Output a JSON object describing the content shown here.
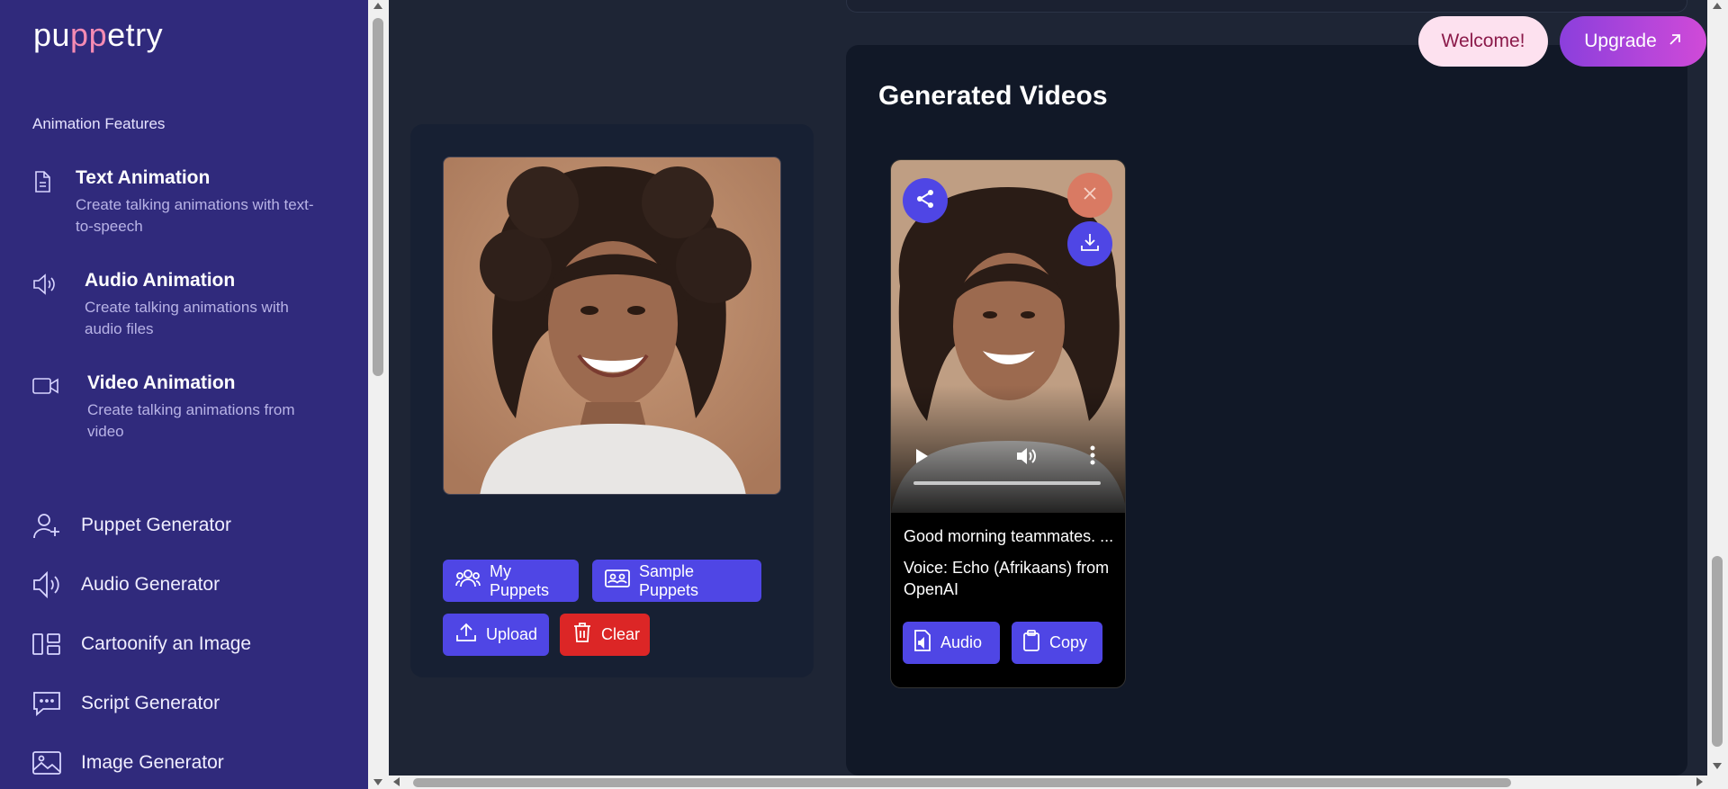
{
  "logo": {
    "pre": "pu",
    "mid": "pp",
    "post": "etry"
  },
  "sidebar": {
    "section_title": "Animation Features",
    "features": [
      {
        "icon": "document-icon",
        "title": "Text Animation",
        "desc": "Create talking animations with text-to-speech"
      },
      {
        "icon": "speaker-icon",
        "title": "Audio Animation",
        "desc": "Create talking animations with audio files"
      },
      {
        "icon": "video-camera-icon",
        "title": "Video Animation",
        "desc": "Create talking animations from video"
      }
    ],
    "nav": [
      {
        "icon": "user-plus-icon",
        "label": "Puppet Generator"
      },
      {
        "icon": "speaker-icon",
        "label": "Audio Generator"
      },
      {
        "icon": "layout-icon",
        "label": "Cartoonify an Image"
      },
      {
        "icon": "chat-bubble-icon",
        "label": "Script Generator"
      },
      {
        "icon": "image-icon",
        "label": "Image Generator"
      }
    ]
  },
  "header": {
    "welcome": "Welcome!",
    "upgrade": "Upgrade"
  },
  "puppet_panel": {
    "my_puppets": "My Puppets",
    "sample_puppets": "Sample Puppets",
    "upload": "Upload",
    "clear": "Clear"
  },
  "generated": {
    "title": "Generated Videos",
    "videos": [
      {
        "text": "Good morning teammates. ...",
        "voice": "Voice: Echo (Afrikaans) from OpenAI",
        "audio_label": "Audio",
        "copy_label": "Copy"
      }
    ]
  },
  "colors": {
    "sidebar": "#302a7c",
    "primary": "#4f46e5",
    "danger": "#dc2626",
    "panel": "#111827"
  }
}
